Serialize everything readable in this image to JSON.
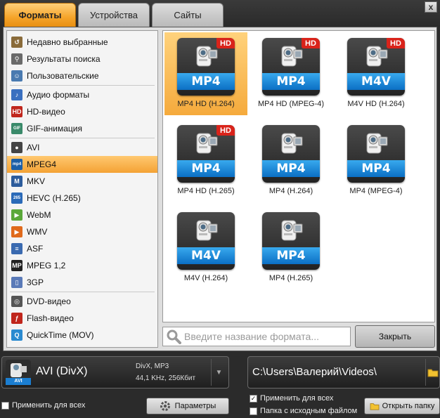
{
  "tabs": [
    {
      "label": "Форматы",
      "active": true
    },
    {
      "label": "Устройства",
      "active": false
    },
    {
      "label": "Сайты",
      "active": false
    }
  ],
  "window_close_glyph": "x",
  "sidebar": {
    "items": [
      {
        "label": "Недавно выбранные",
        "icon": "recent-icon"
      },
      {
        "label": "Результаты поиска",
        "icon": "search-results-icon"
      },
      {
        "label": "Пользовательские",
        "icon": "user-icon"
      },
      {
        "label": "Аудио форматы",
        "icon": "music-note-icon"
      },
      {
        "label": "HD-видео",
        "icon": "hd-icon"
      },
      {
        "label": "GIF-анимация",
        "icon": "gif-icon"
      },
      {
        "label": "AVI",
        "icon": "avi-icon"
      },
      {
        "label": "MPEG4",
        "icon": "mp4-icon",
        "selected": true
      },
      {
        "label": "MKV",
        "icon": "mkv-icon"
      },
      {
        "label": "HEVC (H.265)",
        "icon": "hevc-icon"
      },
      {
        "label": "WebM",
        "icon": "webm-icon"
      },
      {
        "label": "WMV",
        "icon": "wmv-icon"
      },
      {
        "label": "ASF",
        "icon": "asf-icon"
      },
      {
        "label": "MPEG 1,2",
        "icon": "mpeg-icon"
      },
      {
        "label": "3GP",
        "icon": "3gp-icon"
      },
      {
        "label": "DVD-видео",
        "icon": "dvd-icon"
      },
      {
        "label": "Flash-видео",
        "icon": "flash-icon"
      },
      {
        "label": "QuickTime (MOV)",
        "icon": "quicktime-icon"
      }
    ]
  },
  "formats": [
    {
      "badge": "MP4",
      "hd": true,
      "caption": "MP4 HD (H.264)",
      "selected": true
    },
    {
      "badge": "MP4",
      "hd": true,
      "caption": "MP4 HD (MPEG-4)"
    },
    {
      "badge": "M4V",
      "hd": true,
      "caption": "M4V HD (H.264)"
    },
    {
      "badge": "MP4",
      "hd": true,
      "caption": "MP4 HD (H.265)"
    },
    {
      "badge": "MP4",
      "hd": false,
      "caption": "MP4 (H.264)"
    },
    {
      "badge": "MP4",
      "hd": false,
      "caption": "MP4 (MPEG-4)"
    },
    {
      "badge": "M4V",
      "hd": false,
      "caption": "M4V (H.264)"
    },
    {
      "badge": "MP4",
      "hd": false,
      "caption": "MP4 (H.265)"
    }
  ],
  "hd_label": "HD",
  "search": {
    "placeholder": "Введите название формата..."
  },
  "close_button": "Закрыть",
  "output": {
    "format_icon_label": "AVI",
    "format_name": "AVI (DivX)",
    "format_codecs": "DivX, MP3",
    "format_audio": "44,1 KHz, 256Кбит",
    "apply_all_label": "Применить для всех",
    "params_label": "Параметры"
  },
  "destination": {
    "path": "C:\\Users\\Валерий\\Videos\\",
    "apply_all_label": "Применить для всех",
    "apply_all_checked": true,
    "source_folder_label": "Папка с исходным файлом",
    "source_folder_checked": false,
    "open_folder_label": "Открыть папку"
  },
  "colors": {
    "accent_orange": "#f5a42a",
    "badge_blue": "#0b6fc4",
    "hd_red": "#d9231a"
  }
}
